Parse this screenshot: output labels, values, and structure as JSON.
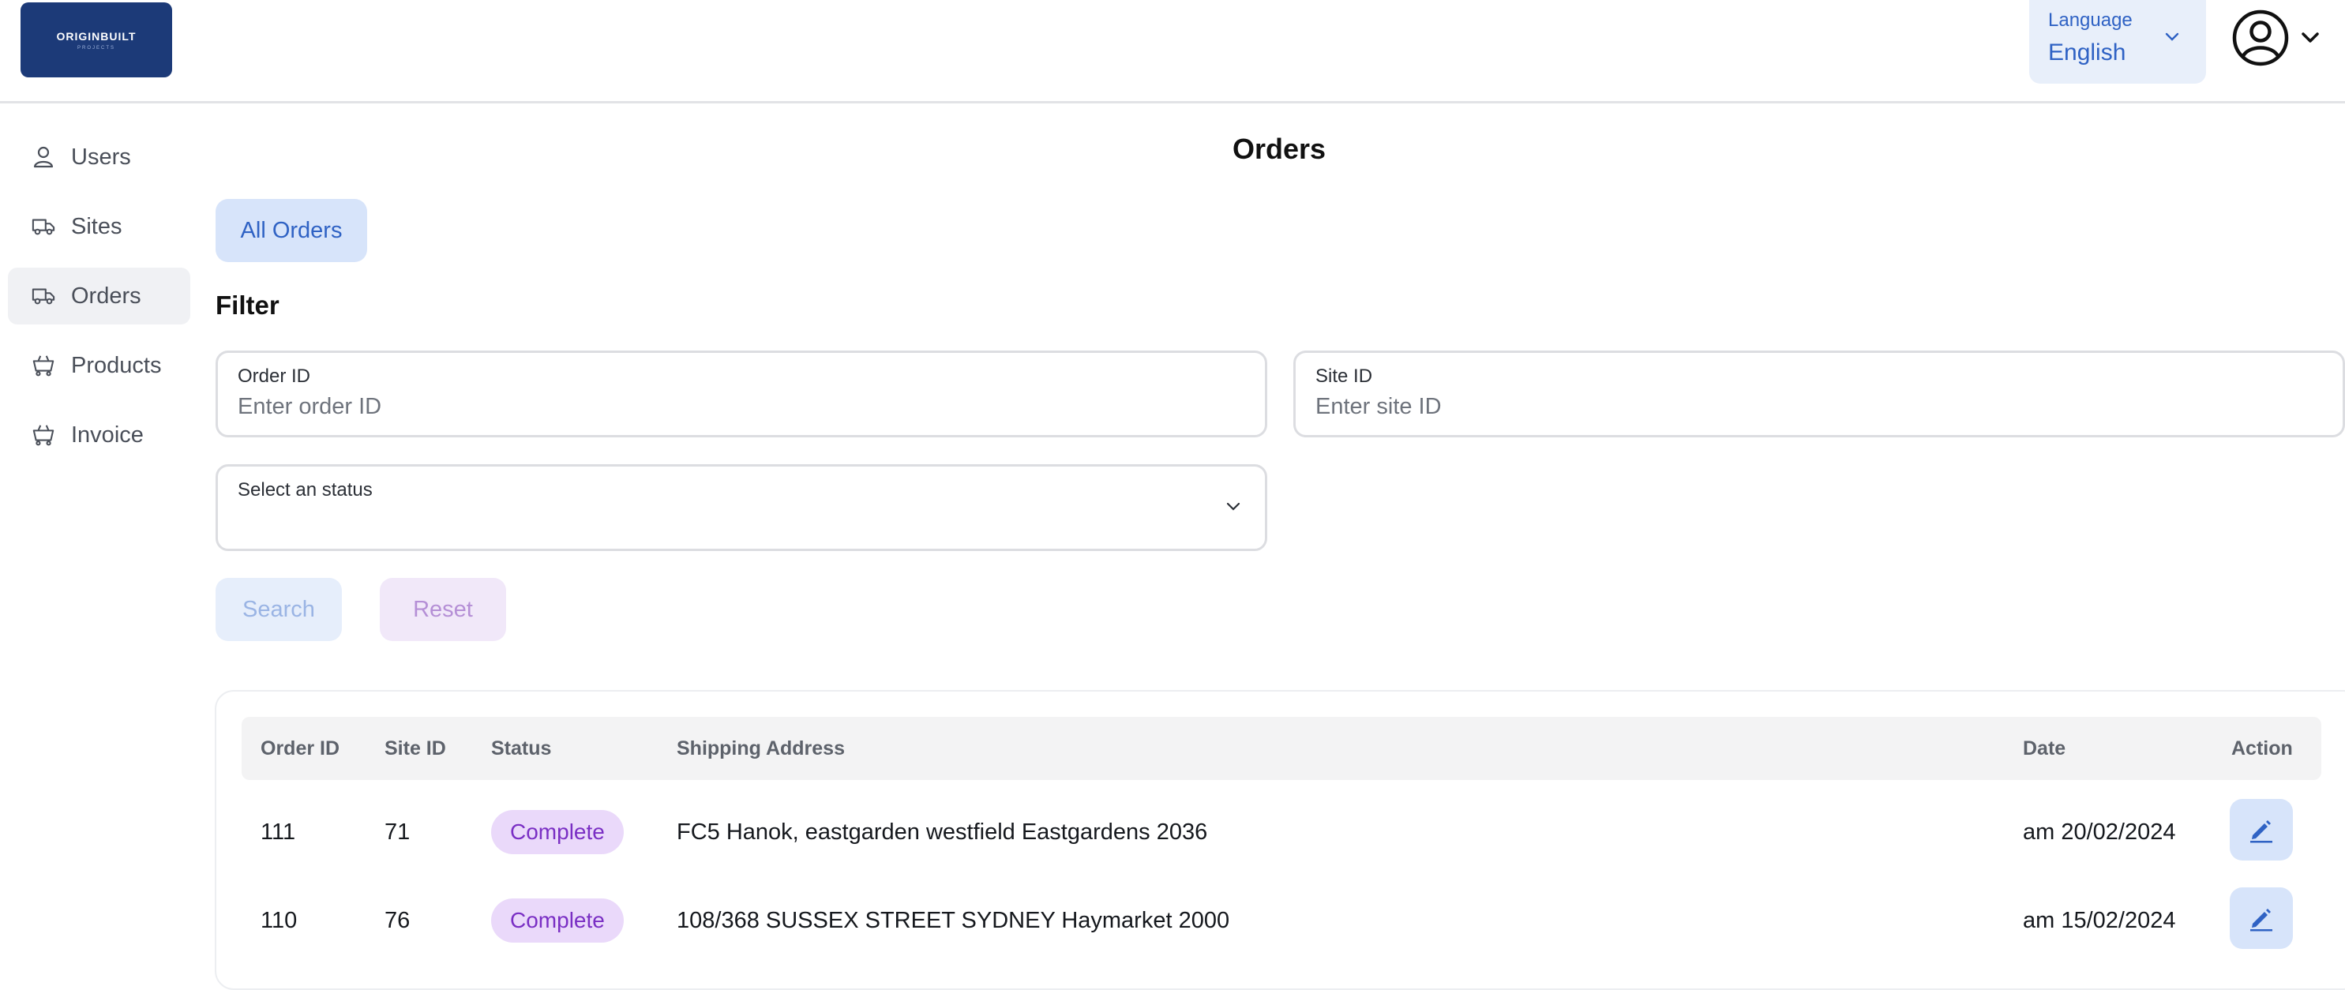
{
  "header": {
    "logo_text": "ORIGINBUILT",
    "logo_subtext": "PROJECTS",
    "language_label": "Language",
    "language_value": "English"
  },
  "sidebar": {
    "items": [
      {
        "label": "Users",
        "icon": "user-icon"
      },
      {
        "label": "Sites",
        "icon": "truck-icon"
      },
      {
        "label": "Orders",
        "icon": "truck-icon",
        "active": true
      },
      {
        "label": "Products",
        "icon": "cart-icon"
      },
      {
        "label": "Invoice",
        "icon": "cart-icon"
      }
    ]
  },
  "main": {
    "title": "Orders",
    "tab_all": "All Orders",
    "filter_heading": "Filter",
    "order_id_label": "Order ID",
    "order_id_placeholder": "Enter order ID",
    "site_id_label": "Site ID",
    "site_id_placeholder": "Enter site ID",
    "status_label": "Select an status",
    "search_label": "Search",
    "reset_label": "Reset"
  },
  "table": {
    "columns": [
      "Order ID",
      "Site ID",
      "Status",
      "Shipping Address",
      "Date",
      "Action"
    ],
    "rows": [
      {
        "order_id": "111",
        "site_id": "71",
        "status": "Complete",
        "address": "FC5 Hanok, eastgarden westfield Eastgardens 2036",
        "date": "am 20/02/2024"
      },
      {
        "order_id": "110",
        "site_id": "76",
        "status": "Complete",
        "address": "108/368 SUSSEX STREET SYDNEY Haymarket 2000",
        "date": "am 15/02/2024"
      }
    ]
  },
  "colors": {
    "brand_navy": "#1c3a78",
    "accent_blue": "#2f62c4",
    "status_purple": "#7a2fc4"
  }
}
